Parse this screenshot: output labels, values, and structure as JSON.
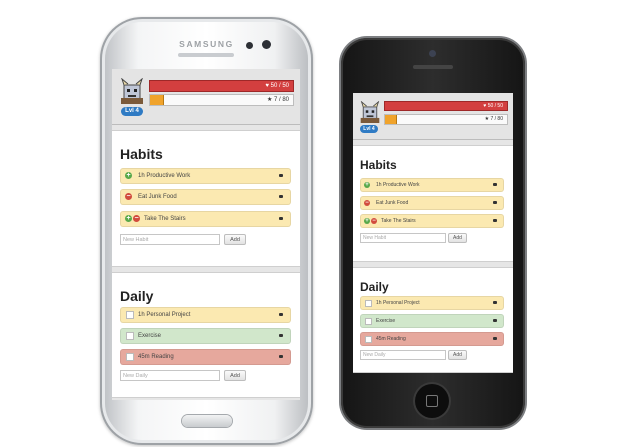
{
  "phones": [
    {
      "brand": "SAMSUNG",
      "hp": "♥ 50 / 50",
      "xp": "★ 7 / 80",
      "xp_fraction": 0.0875,
      "level": "Lvl 4",
      "habits_title": "Habits",
      "daily_title": "Daily",
      "habits": [
        "1h Productive Work",
        "Eat Junk Food",
        "Take The Stairs"
      ],
      "dailies": [
        "1h Personal Project",
        "Exercise",
        "45m Reading"
      ],
      "new_habit_placeholder": "New Habit",
      "new_daily_placeholder": "New Daily",
      "add_label": "Add"
    },
    {
      "hp": "♥ 50 / 50",
      "xp": "★ 7 / 80",
      "xp_fraction": 0.0875,
      "level": "Lvl 4",
      "habits_title": "Habits",
      "daily_title": "Daily",
      "habits": [
        "1h Productive Work",
        "Eat Junk Food",
        "Take The Stairs"
      ],
      "dailies": [
        "1h Personal Project",
        "Exercise",
        "45m Reading"
      ],
      "new_habit_placeholder": "New Habit",
      "new_daily_placeholder": "New Daily",
      "add_label": "Add"
    }
  ],
  "colors": {
    "habit": "#fbe9b1",
    "daily_done": "#d1e7cb",
    "daily_due": "#e6a89d",
    "hp_bar": "#d33f3f",
    "xp_bar": "#f0a32b",
    "level_badge": "#2f7bc4"
  }
}
